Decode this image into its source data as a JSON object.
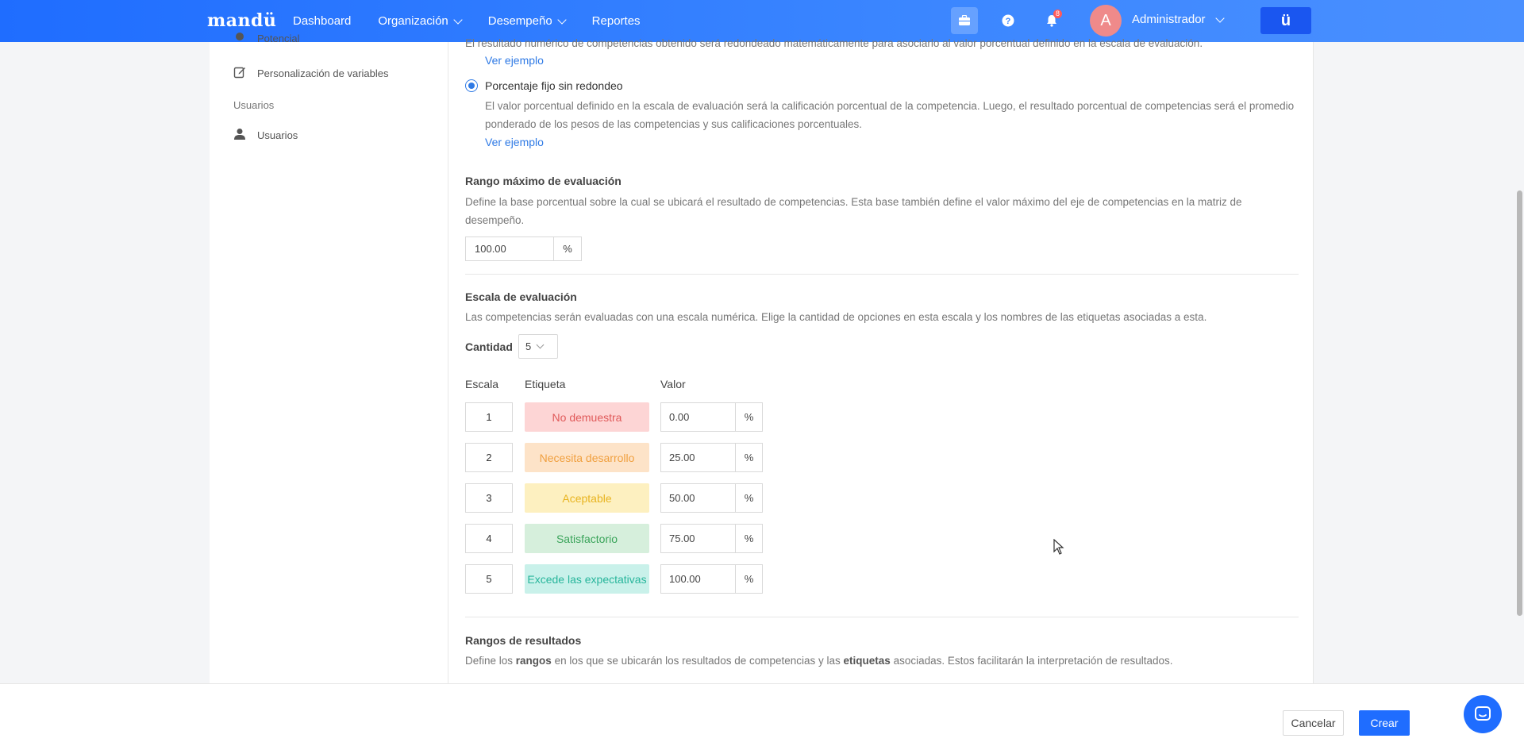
{
  "header": {
    "logo": "mandü",
    "nav": [
      {
        "label": "Dashboard",
        "dropdown": false
      },
      {
        "label": "Organización",
        "dropdown": true
      },
      {
        "label": "Desempeño",
        "dropdown": true
      },
      {
        "label": "Reportes",
        "dropdown": false
      }
    ],
    "notification_count": "8",
    "avatar_initial": "A",
    "user_name": "Administrador",
    "brand_button": "ü"
  },
  "sidebar": {
    "partial_item": "Potencial",
    "item_variables": "Personalización de variables",
    "group_users": "Usuarios",
    "item_users": "Usuarios"
  },
  "main": {
    "cut_text": "El resultado numérico de competencias obtenido será redondeado matemáticamente para asociarlo al valor porcentual definido en la escala de evaluación.",
    "example_link_1": "Ver ejemplo",
    "radio_label": "Porcentaje fijo sin redondeo",
    "radio_desc": "El valor porcentual definido en la escala de evaluación será la calificación porcentual de la competencia. Luego, el resultado porcentual de competencias será el promedio ponderado de los pesos de las competencias y sus calificaciones porcentuales.",
    "example_link_2": "Ver ejemplo",
    "range": {
      "title": "Rango máximo de evaluación",
      "desc": "Define la base porcentual sobre la cual se ubicará el resultado de competencias. Esta base también define el valor máximo del eje de competencias en la matriz de desempeño.",
      "value": "100.00",
      "unit": "%"
    },
    "scale": {
      "title": "Escala de evaluación",
      "desc": "Las competencias serán evaluadas con una escala numérica. Elige la cantidad de opciones en esta escala y los nombres de las etiquetas asociadas a esta.",
      "quantity_label": "Cantidad",
      "quantity_value": "5",
      "col_scale": "Escala",
      "col_label": "Etiqueta",
      "col_value": "Valor",
      "rows": [
        {
          "num": "1",
          "label": "No demuestra",
          "value": "0.00",
          "unit": "%",
          "bg": "#fdd5d5",
          "fg": "#e05a5a"
        },
        {
          "num": "2",
          "label": "Necesita desarrollo",
          "value": "25.00",
          "unit": "%",
          "bg": "#fde3c8",
          "fg": "#f0a040"
        },
        {
          "num": "3",
          "label": "Aceptable",
          "value": "50.00",
          "unit": "%",
          "bg": "#fdf0c0",
          "fg": "#e8b420"
        },
        {
          "num": "4",
          "label": "Satisfactorio",
          "value": "75.00",
          "unit": "%",
          "bg": "#d6efdc",
          "fg": "#3aa45a"
        },
        {
          "num": "5",
          "label": "Excede las expectativas",
          "value": "100.00",
          "unit": "%",
          "bg": "#c9f1ea",
          "fg": "#27b59b"
        }
      ]
    },
    "results": {
      "title": "Rangos de resultados",
      "desc_1": "Define los ",
      "desc_bold_1": "rangos",
      "desc_2": " en los que se ubicarán los resultados de competencias y las ",
      "desc_bold_2": "etiquetas",
      "desc_3": " asociadas. Estos facilitarán la interpretación de resultados."
    }
  },
  "footer": {
    "cancel": "Cancelar",
    "create": "Crear"
  }
}
